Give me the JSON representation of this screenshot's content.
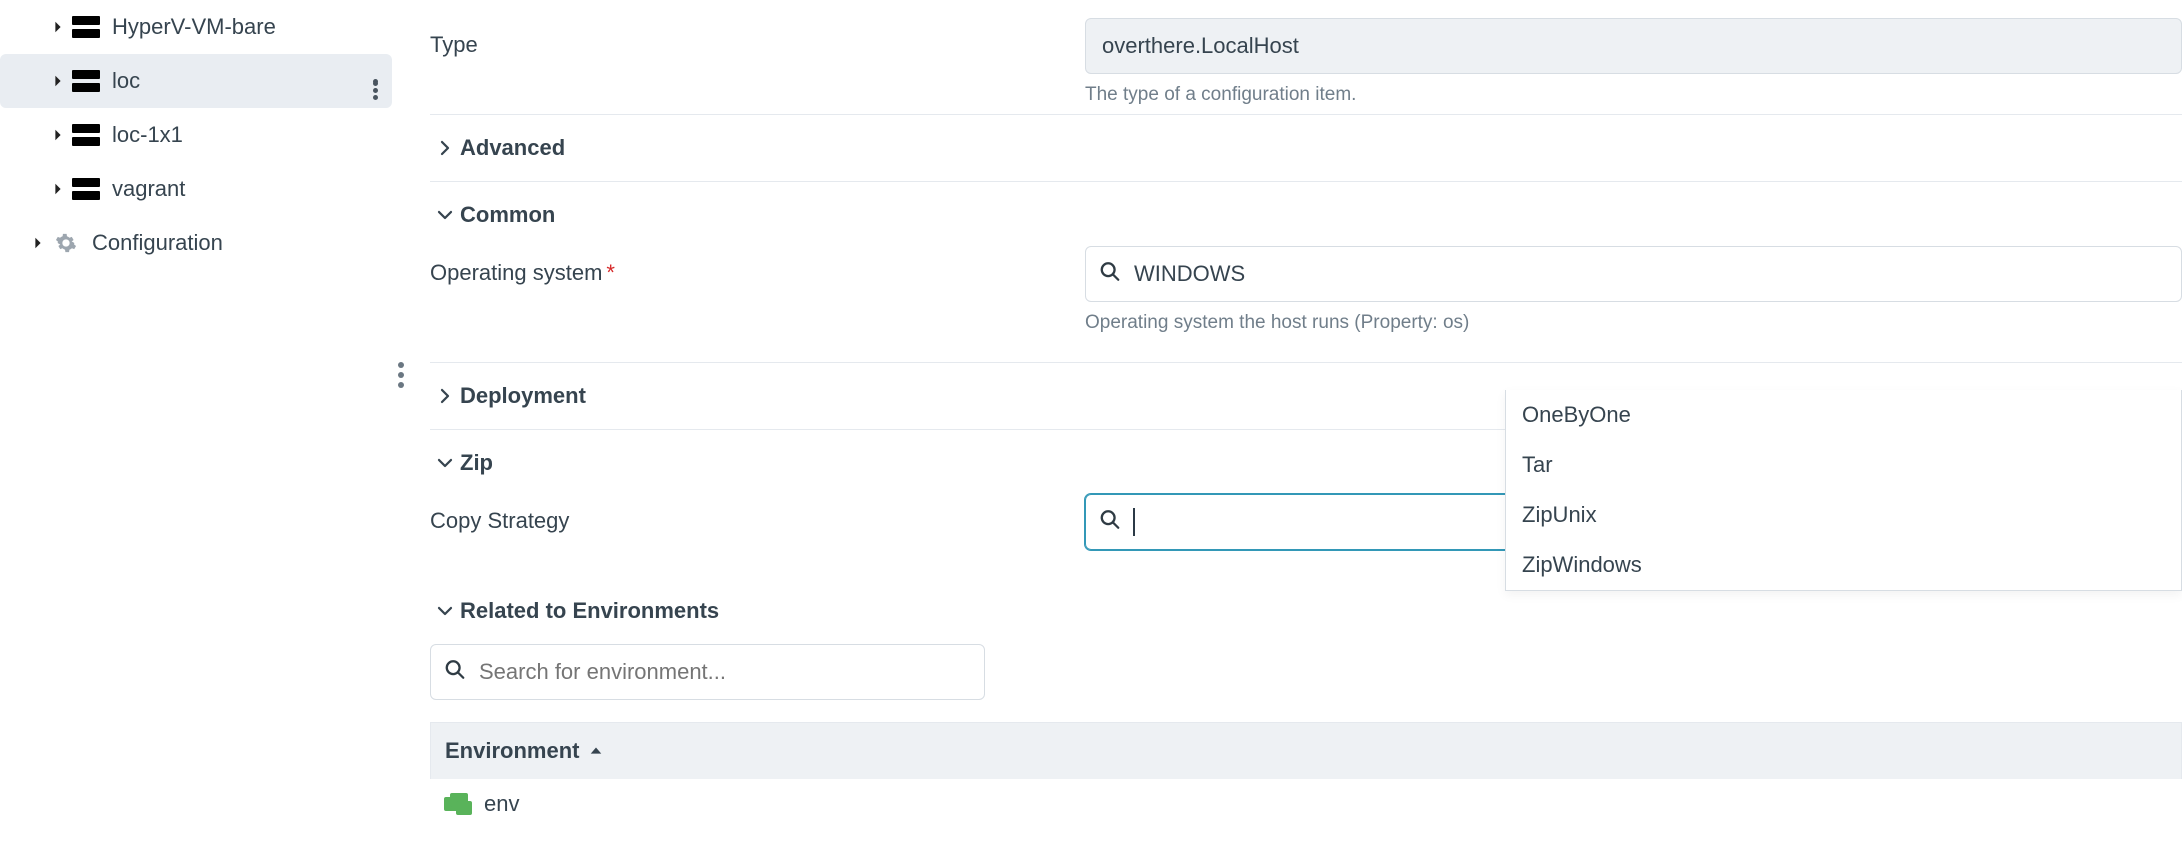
{
  "sidebar": {
    "items": [
      {
        "label": "HyperV-VM-bare",
        "icon": "server",
        "depth": 2,
        "expandable": true,
        "selected": false
      },
      {
        "label": "loc",
        "icon": "server",
        "depth": 2,
        "expandable": true,
        "selected": true
      },
      {
        "label": "loc-1x1",
        "icon": "server",
        "depth": 2,
        "expandable": true,
        "selected": false
      },
      {
        "label": "vagrant",
        "icon": "server",
        "depth": 2,
        "expandable": true,
        "selected": false
      },
      {
        "label": "Configuration",
        "icon": "gear",
        "depth": 1,
        "expandable": true,
        "selected": false
      }
    ]
  },
  "form": {
    "type_label": "Type",
    "type_value": "overthere.LocalHost",
    "type_help": "The type of a configuration item.",
    "advanced_label": "Advanced",
    "common_label": "Common",
    "os_label": "Operating system",
    "os_required": "*",
    "os_value": "WINDOWS",
    "os_help": "Operating system the host runs (Property: os)",
    "deployment_label": "Deployment",
    "zip_label": "Zip",
    "copy_strategy_label": "Copy Strategy",
    "copy_strategy_value": "",
    "env_section_label": "Related to Environments",
    "env_search_placeholder": "Search for environment...",
    "env_column_label": "Environment",
    "env_rows": [
      {
        "label": "env"
      }
    ]
  },
  "dropdown": {
    "options": [
      {
        "label": "OneByOne"
      },
      {
        "label": "Tar"
      },
      {
        "label": "ZipUnix"
      },
      {
        "label": "ZipWindows"
      }
    ]
  }
}
